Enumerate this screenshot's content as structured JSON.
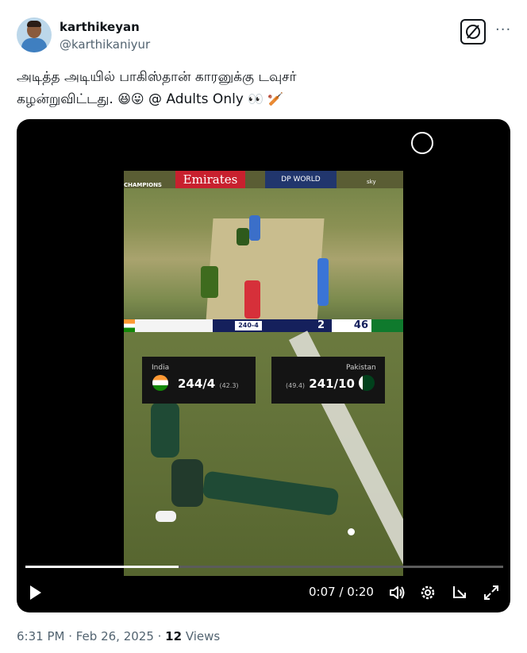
{
  "author": {
    "name": "karthikeyan",
    "handle": "@karthikaniyur"
  },
  "tweet": {
    "line1": "அடித்த அடியில் பாகிஸ்தான் காரனுக்கு டவுசர்",
    "line2_text": "கழன்றுவிட்டது.",
    "line2_emojis": "😆😛",
    "line2_tail": "@ Adults Only",
    "line2_end_emojis": "👀 🏏"
  },
  "icons": {
    "grok": "grok-icon",
    "more": "more-icon",
    "play": "play-icon",
    "volume": "volume-icon",
    "settings": "gear-icon",
    "pip": "picture-in-picture-icon",
    "fullscreen": "fullscreen-icon"
  },
  "video": {
    "frame_ads": {
      "emirates": "Emirates",
      "dpworld": "DP WORLD",
      "champions": "CHAMPIONS",
      "broadcaster": "sky"
    },
    "scorebar": {
      "score": "240-4",
      "number": "2",
      "big_number": "46"
    },
    "overlay_left": {
      "team": "India",
      "score": "244/4",
      "overs": "(42.3)"
    },
    "overlay_right": {
      "team": "Pakistan",
      "score": "241/10",
      "overs": "(49.4)"
    },
    "current_time": "0:07",
    "duration": "0:20",
    "time_display": "0:07 / 0:20",
    "progress": 0.32
  },
  "meta": {
    "timestamp": "6:31 PM · Feb 26, 2025 · ",
    "views_count": "12",
    "views_label": "Views"
  }
}
